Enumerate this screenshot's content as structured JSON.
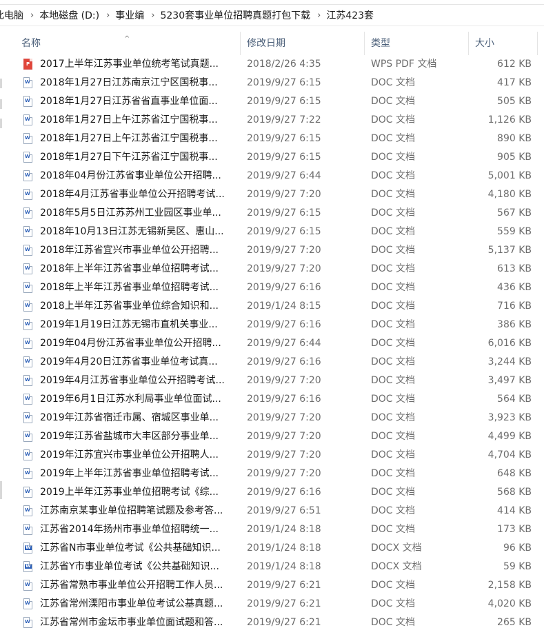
{
  "breadcrumb": [
    "此电脑",
    "本地磁盘 (D:)",
    "事业编",
    "5230套事业单位招聘真题打包下载",
    "江苏423套"
  ],
  "columns": {
    "name": "名称",
    "date": "修改日期",
    "type": "类型",
    "size": "大小"
  },
  "files": [
    {
      "name": "2017上半年江苏事业单位统考笔试真题...",
      "date": "2018/2/26 4:35",
      "type": "WPS PDF 文档",
      "size": "612 KB",
      "icon": "pdf-icon"
    },
    {
      "name": "2018年1月27日江苏南京江宁区国税事...",
      "date": "2019/9/27 6:15",
      "type": "DOC 文档",
      "size": "417 KB",
      "icon": "doc-icon"
    },
    {
      "name": "2018年1月27日江苏省省直事业单位面...",
      "date": "2019/9/27 6:15",
      "type": "DOC 文档",
      "size": "505 KB",
      "icon": "doc-icon"
    },
    {
      "name": "2018年1月27日上午江苏省江宁国税事...",
      "date": "2019/9/27 7:22",
      "type": "DOC 文档",
      "size": "1,126 KB",
      "icon": "doc-icon"
    },
    {
      "name": "2018年1月27日上午江苏省江宁国税事...",
      "date": "2019/9/27 6:15",
      "type": "DOC 文档",
      "size": "890 KB",
      "icon": "doc-icon"
    },
    {
      "name": "2018年1月27日下午江苏省江宁国税事...",
      "date": "2019/9/27 6:15",
      "type": "DOC 文档",
      "size": "905 KB",
      "icon": "doc-icon"
    },
    {
      "name": "2018年04月份江苏省事业单位公开招聘...",
      "date": "2019/9/27 6:44",
      "type": "DOC 文档",
      "size": "5,001 KB",
      "icon": "doc-icon"
    },
    {
      "name": "2018年4月江苏省事业单位公开招聘考试...",
      "date": "2019/9/27 7:20",
      "type": "DOC 文档",
      "size": "4,180 KB",
      "icon": "doc-icon"
    },
    {
      "name": "2018年5月5日江苏苏州工业园区事业单...",
      "date": "2019/9/27 6:15",
      "type": "DOC 文档",
      "size": "567 KB",
      "icon": "doc-icon"
    },
    {
      "name": "2018年10月13日江苏无锡新吴区、惠山...",
      "date": "2019/9/27 6:15",
      "type": "DOC 文档",
      "size": "559 KB",
      "icon": "doc-icon"
    },
    {
      "name": "2018年江苏省宜兴市事业单位公开招聘...",
      "date": "2019/9/27 7:20",
      "type": "DOC 文档",
      "size": "5,137 KB",
      "icon": "doc-icon"
    },
    {
      "name": "2018年上半年江苏省事业单位招聘考试...",
      "date": "2019/9/27 7:20",
      "type": "DOC 文档",
      "size": "613 KB",
      "icon": "doc-icon"
    },
    {
      "name": "2018年上半年江苏省事业单位招聘考试...",
      "date": "2019/9/27 6:16",
      "type": "DOC 文档",
      "size": "436 KB",
      "icon": "doc-icon"
    },
    {
      "name": "2018上半年江苏省事业单位综合知识和...",
      "date": "2019/1/24 8:15",
      "type": "DOC 文档",
      "size": "716 KB",
      "icon": "doc-icon"
    },
    {
      "name": "2019年1月19日江苏无锡市直机关事业...",
      "date": "2019/9/27 6:16",
      "type": "DOC 文档",
      "size": "386 KB",
      "icon": "doc-icon"
    },
    {
      "name": "2019年04月份江苏省事业单位公开招聘...",
      "date": "2019/9/27 6:44",
      "type": "DOC 文档",
      "size": "6,016 KB",
      "icon": "doc-icon"
    },
    {
      "name": "2019年4月20日江苏省事业单位考试真...",
      "date": "2019/9/27 6:16",
      "type": "DOC 文档",
      "size": "3,244 KB",
      "icon": "doc-icon"
    },
    {
      "name": "2019年4月江苏省事业单位公开招聘考试...",
      "date": "2019/9/27 7:20",
      "type": "DOC 文档",
      "size": "3,497 KB",
      "icon": "doc-icon"
    },
    {
      "name": "2019年6月1日江苏水利局事业单位面试...",
      "date": "2019/9/27 6:16",
      "type": "DOC 文档",
      "size": "564 KB",
      "icon": "doc-icon"
    },
    {
      "name": "2019年江苏省宿迁市属、宿城区事业单...",
      "date": "2019/9/27 7:20",
      "type": "DOC 文档",
      "size": "3,923 KB",
      "icon": "doc-icon"
    },
    {
      "name": "2019年江苏省盐城市大丰区部分事业单...",
      "date": "2019/9/27 7:20",
      "type": "DOC 文档",
      "size": "4,499 KB",
      "icon": "doc-icon"
    },
    {
      "name": "2019年江苏宜兴市事业单位公开招聘人...",
      "date": "2019/9/27 7:20",
      "type": "DOC 文档",
      "size": "4,704 KB",
      "icon": "doc-icon"
    },
    {
      "name": "2019年上半年江苏省事业单位招聘考试...",
      "date": "2019/9/27 7:20",
      "type": "DOC 文档",
      "size": "648 KB",
      "icon": "doc-icon"
    },
    {
      "name": "2019上半年江苏事业单位招聘考试《综...",
      "date": "2019/9/27 6:16",
      "type": "DOC 文档",
      "size": "568 KB",
      "icon": "doc-icon"
    },
    {
      "name": "江苏南京某事业单位招聘笔试题及参考答...",
      "date": "2019/9/27 6:51",
      "type": "DOC 文档",
      "size": "414 KB",
      "icon": "doc-icon"
    },
    {
      "name": "江苏省2014年扬州市事业单位招聘统一...",
      "date": "2019/1/24 8:18",
      "type": "DOC 文档",
      "size": "173 KB",
      "icon": "doc-icon"
    },
    {
      "name": "江苏省N市事业单位考试《公共基础知识...",
      "date": "2019/1/24 8:18",
      "type": "DOCX 文档",
      "size": "96 KB",
      "icon": "docx-icon"
    },
    {
      "name": "江苏省Y市事业单位考试《公共基础知识...",
      "date": "2019/1/24 8:18",
      "type": "DOCX 文档",
      "size": "59 KB",
      "icon": "docx-icon"
    },
    {
      "name": "江苏省常熟市事业单位公开招聘工作人员...",
      "date": "2019/9/27 6:21",
      "type": "DOC 文档",
      "size": "2,158 KB",
      "icon": "doc-icon"
    },
    {
      "name": "江苏省常州溧阳市事业单位考试公基真题...",
      "date": "2019/9/27 6:21",
      "type": "DOC 文档",
      "size": "4,020 KB",
      "icon": "doc-icon"
    },
    {
      "name": "江苏省常州市金坛市事业单位面试题和答...",
      "date": "2019/9/27 6:21",
      "type": "DOC 文档",
      "size": "265 KB",
      "icon": "doc-icon"
    }
  ]
}
